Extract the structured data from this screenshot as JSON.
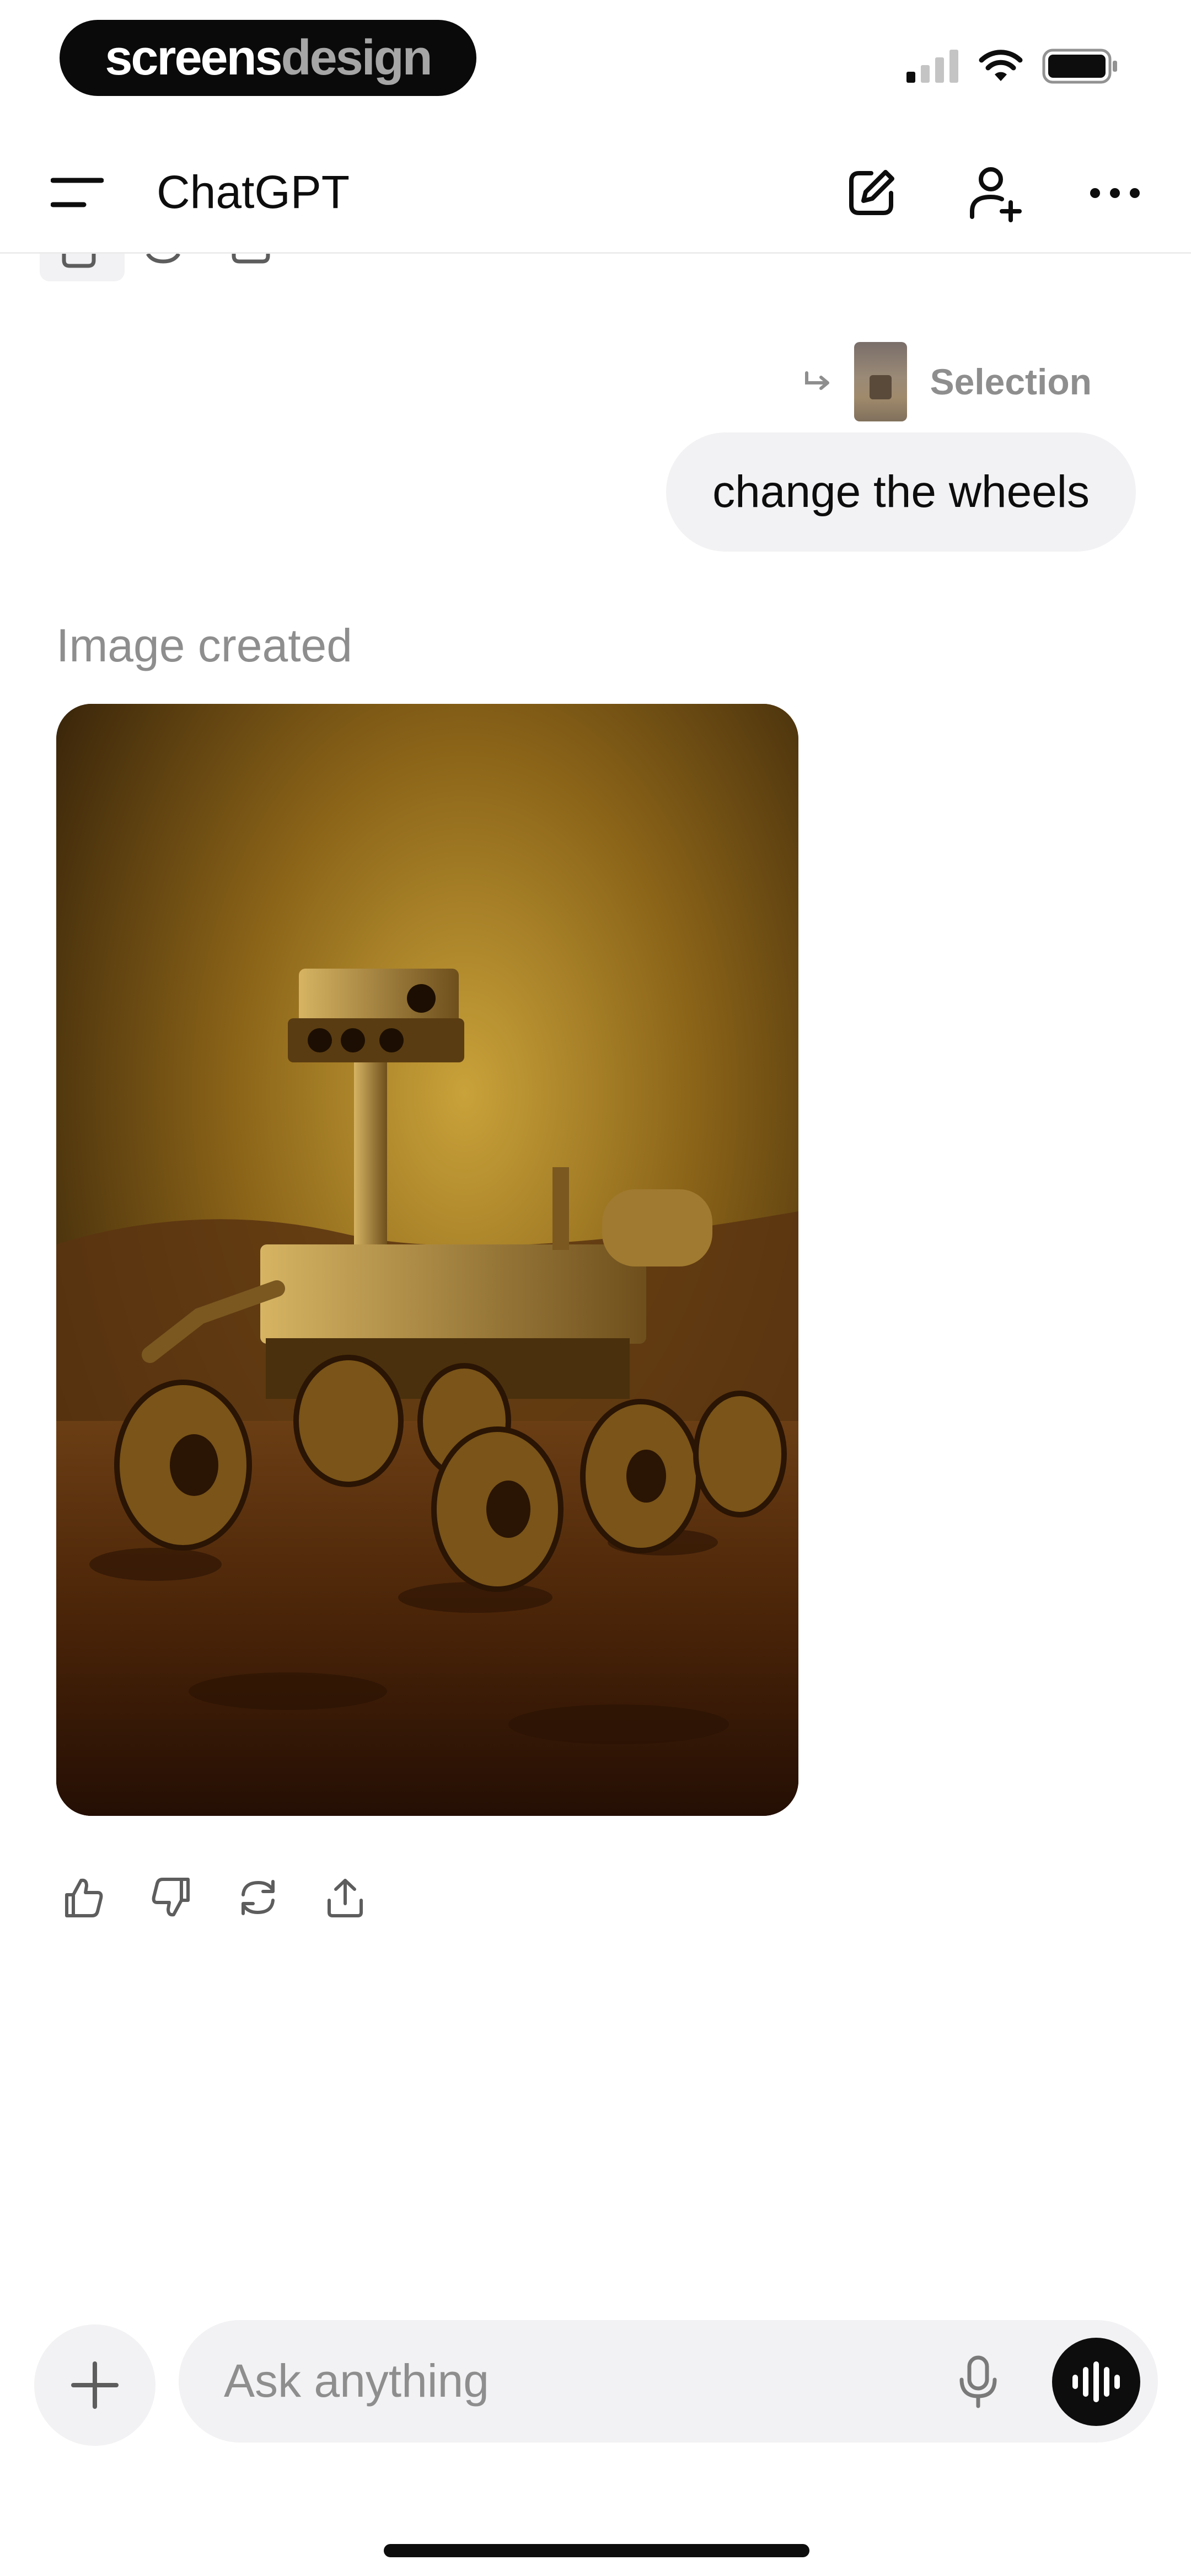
{
  "status_bar": {
    "watermark_part1": "screens",
    "watermark_part2": "design",
    "icons": [
      "cellular-signal-icon",
      "wifi-icon",
      "battery-icon"
    ]
  },
  "header": {
    "title": "ChatGPT",
    "icons": [
      "menu-icon",
      "new-chat-icon",
      "add-person-icon",
      "more-icon"
    ]
  },
  "conversation": {
    "selection_label": "Selection",
    "user_message": "change the wheels",
    "assistant_label": "Image created",
    "image_description": "Painting of a Mars rover on rocky terrain in sepia tones",
    "actions": [
      "thumbs-up-icon",
      "thumbs-down-icon",
      "regenerate-icon",
      "share-icon"
    ]
  },
  "composer": {
    "placeholder": "Ask anything",
    "icons": [
      "plus-icon",
      "microphone-icon",
      "voice-mode-icon"
    ]
  },
  "colors": {
    "background": "#ffffff",
    "bubble": "#f2f2f4",
    "muted_text": "#8e8e8e",
    "primary_text": "#0d0d0d"
  }
}
